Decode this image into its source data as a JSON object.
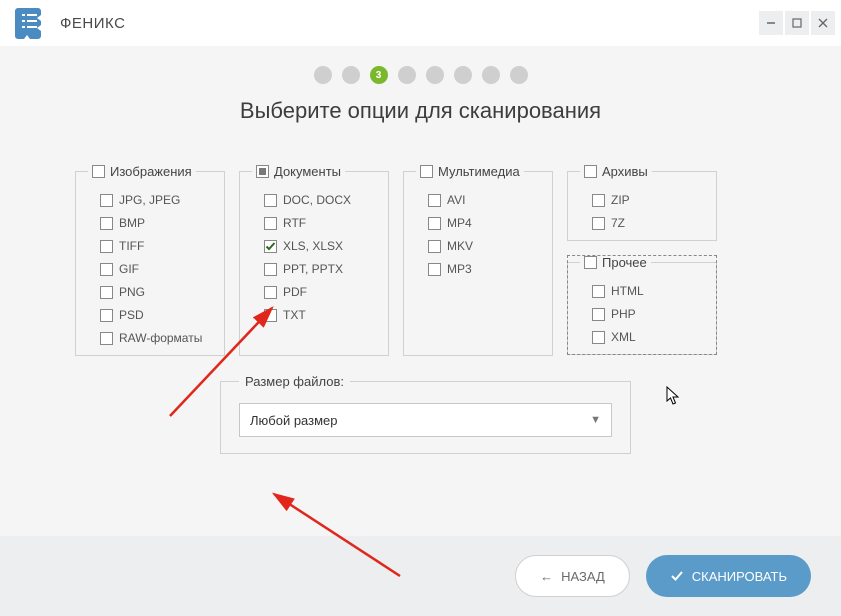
{
  "app": {
    "title": "ФЕНИКС"
  },
  "stepper": {
    "total": 8,
    "active": 3,
    "active_label": "3"
  },
  "heading": "Выберите опции для сканирования",
  "groups": {
    "images": {
      "title": "Изображения",
      "state": "unchecked",
      "items": [
        "JPG, JPEG",
        "BMP",
        "TIFF",
        "GIF",
        "PNG",
        "PSD",
        "RAW-форматы"
      ]
    },
    "documents": {
      "title": "Документы",
      "state": "indeterminate",
      "items": [
        "DOC, DOCX",
        "RTF",
        "XLS, XLSX",
        "PPT, PPTX",
        "PDF",
        "TXT"
      ],
      "checked": [
        "XLS, XLSX"
      ]
    },
    "multimedia": {
      "title": "Мультимедиа",
      "state": "unchecked",
      "items": [
        "AVI",
        "MP4",
        "MKV",
        "MP3"
      ]
    },
    "archives": {
      "title": "Архивы",
      "state": "unchecked",
      "items": [
        "ZIP",
        "7Z"
      ]
    },
    "other": {
      "title": "Прочее",
      "state": "unchecked",
      "items": [
        "HTML",
        "PHP",
        "XML"
      ]
    }
  },
  "size": {
    "label": "Размер файлов:",
    "value": "Любой размер"
  },
  "buttons": {
    "back": "НАЗАД",
    "scan": "СКАНИРОВАТЬ"
  },
  "colors": {
    "accent_green": "#7ab92e",
    "accent_blue": "#5a9bc9",
    "arrow_red": "#e1261c"
  }
}
